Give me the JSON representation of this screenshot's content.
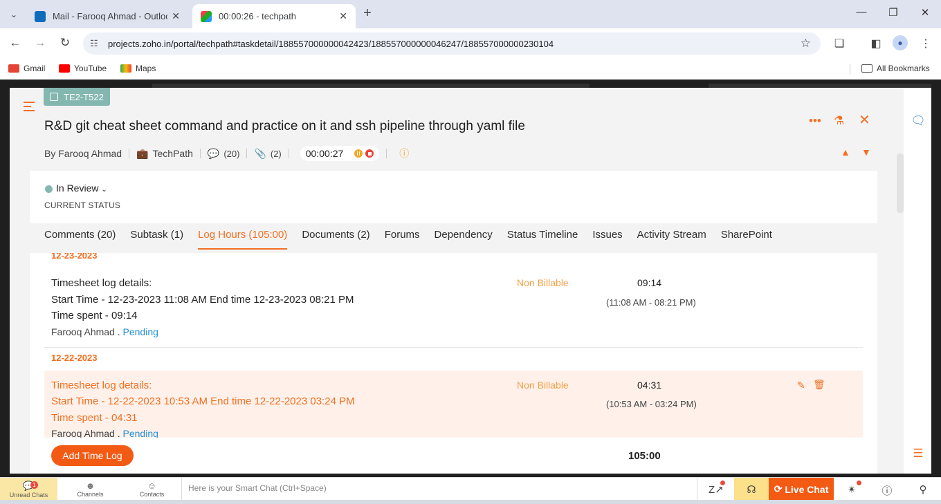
{
  "browser": {
    "tabs": [
      {
        "title": "Mail - Farooq Ahmad - Outlook",
        "active": false
      },
      {
        "title": "00:00:26 - techpath",
        "active": true
      }
    ],
    "url": "projects.zoho.in/portal/techpath#taskdetail/188557000000042423/188557000000046247/188557000000230104",
    "bookmarks": [
      "Gmail",
      "YouTube",
      "Maps"
    ],
    "all_bookmarks": "All Bookmarks"
  },
  "task": {
    "id": "TE2-T522",
    "title": "R&D git cheat sheet command and practice on it and ssh pipeline through yaml file",
    "author": "By Farooq Ahmad",
    "project": "TechPath",
    "comments_count": "(20)",
    "attachments_count": "(2)",
    "timer": "00:00:27",
    "status": "In Review",
    "status_label": "CURRENT STATUS",
    "status_color": "#84b7b0"
  },
  "tabs": [
    "Comments (20)",
    "Subtask (1)",
    "Log Hours (105:00)",
    "Documents (2)",
    "Forums",
    "Dependency",
    "Status Timeline",
    "Issues",
    "Activity Stream",
    "SharePoint"
  ],
  "logs": [
    {
      "date": "12-23-2023",
      "heading": "Timesheet log details:",
      "times": "Start Time - 12-23-2023 11:08 AM End time 12-23-2023 08:21 PM",
      "spent": "Time spent - 09:14",
      "user": "Farooq Ahmad",
      "sep": " . ",
      "approval": "Pending",
      "billing": "Non Billable",
      "duration": "09:14",
      "range": "(11:08 AM - 08:21 PM)"
    },
    {
      "date": "12-22-2023",
      "heading": "Timesheet log details:",
      "times": "Start Time - 12-22-2023 10:53 AM End time 12-22-2023 03:24 PM",
      "spent": "Time spent - 04:31",
      "user": "Farooq Ahmad",
      "sep": " . ",
      "approval": "Pending",
      "billing": "Non Billable",
      "duration": "04:31",
      "range": "(10:53 AM - 03:24 PM)"
    }
  ],
  "footer": {
    "add_button": "Add Time Log",
    "total": "105:00"
  },
  "zoho_bar": {
    "unread": "Unread Chats",
    "unread_count": "1",
    "channels": "Channels",
    "contacts": "Contacts",
    "smart_placeholder": "Here is your Smart Chat (Ctrl+Space)",
    "live_chat": "Live Chat"
  },
  "colors": {
    "accent": "#f36f21",
    "pending": "#1e8ed8",
    "non_billable": "#f5a046"
  }
}
